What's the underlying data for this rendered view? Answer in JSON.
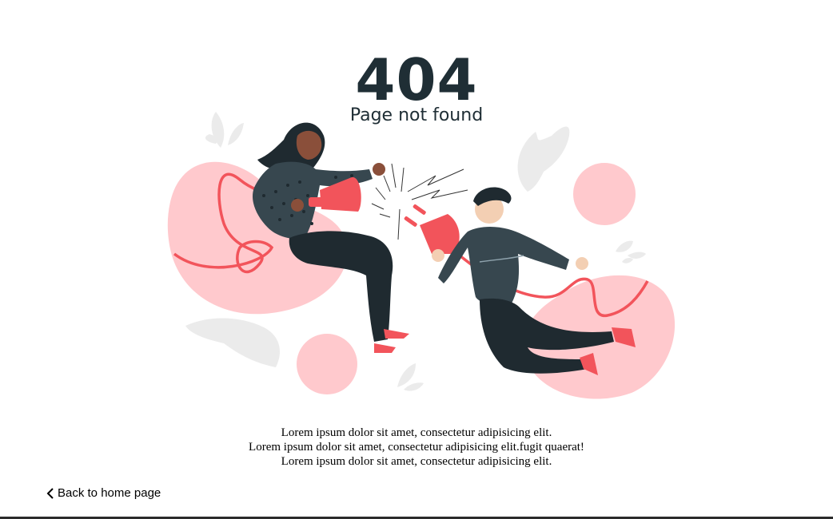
{
  "error": {
    "code": "404",
    "title": "Page not found"
  },
  "message": {
    "lines": [
      "Lorem ipsum dolor sit amet, consectetur adipisicing elit.",
      "Lorem ipsum dolor sit amet, consectetur adipisicing elit.fugit quaerat!",
      "Lorem ipsum dolor sit amet, consectetur adipisicing elit."
    ]
  },
  "nav": {
    "back_label": "Back to home page",
    "back_icon": "chevron-left-icon"
  },
  "colors": {
    "heading": "#1f2e35",
    "accent_red": "#f2545b",
    "blob_pink": "#ffc9cd",
    "sweater_dark": "#37474f",
    "pants": "#1f2a30",
    "leaf_gray": "#ebebeb"
  }
}
